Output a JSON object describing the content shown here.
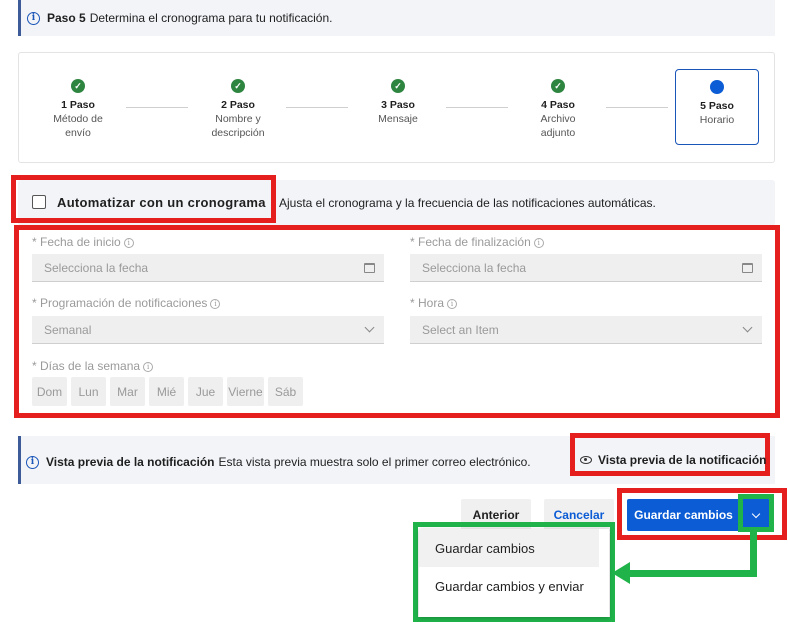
{
  "banner": {
    "step": "Paso 5",
    "text": "Determina el cronograma para tu notificación."
  },
  "steps": [
    {
      "num": "1 Paso",
      "line1": "Método de",
      "line2": "envío"
    },
    {
      "num": "2 Paso",
      "line1": "Nombre y",
      "line2": "descripción"
    },
    {
      "num": "3 Paso",
      "line1": "Mensaje",
      "line2": ""
    },
    {
      "num": "4 Paso",
      "line1": "Archivo",
      "line2": "adjunto"
    },
    {
      "num": "5 Paso",
      "line1": "Horario",
      "line2": ""
    }
  ],
  "automate": {
    "label": "Automatizar con un cronograma",
    "desc": "Ajusta el cronograma y la frecuencia de las notificaciones automáticas."
  },
  "form": {
    "start_label": "* Fecha de inicio",
    "start_placeholder": "Selecciona la fecha",
    "end_label": "* Fecha de finalización",
    "end_placeholder": "Selecciona la fecha",
    "schedule_label": "* Programación de notificaciones",
    "schedule_value": "Semanal",
    "time_label": "* Hora",
    "time_placeholder": "Select an Item",
    "days_label": "* Días de la semana",
    "days": [
      "Dom",
      "Lun",
      "Mar",
      "Mié",
      "Jue",
      "Vierne",
      "Sáb"
    ]
  },
  "preview": {
    "title": "Vista previa de la notificación",
    "text": "Esta vista previa muestra solo el primer correo electrónico.",
    "button": "Vista previa de la notificación"
  },
  "actions": {
    "previous": "Anterior",
    "cancel": "Cancelar",
    "save": "Guardar cambios"
  },
  "menu": {
    "items": [
      "Guardar cambios",
      "Guardar cambios y enviar"
    ]
  },
  "colors": {
    "accent": "#0b5cd5",
    "done": "#2e8540",
    "highlight_red": "#e51e1e",
    "highlight_green": "#1fb34a"
  }
}
